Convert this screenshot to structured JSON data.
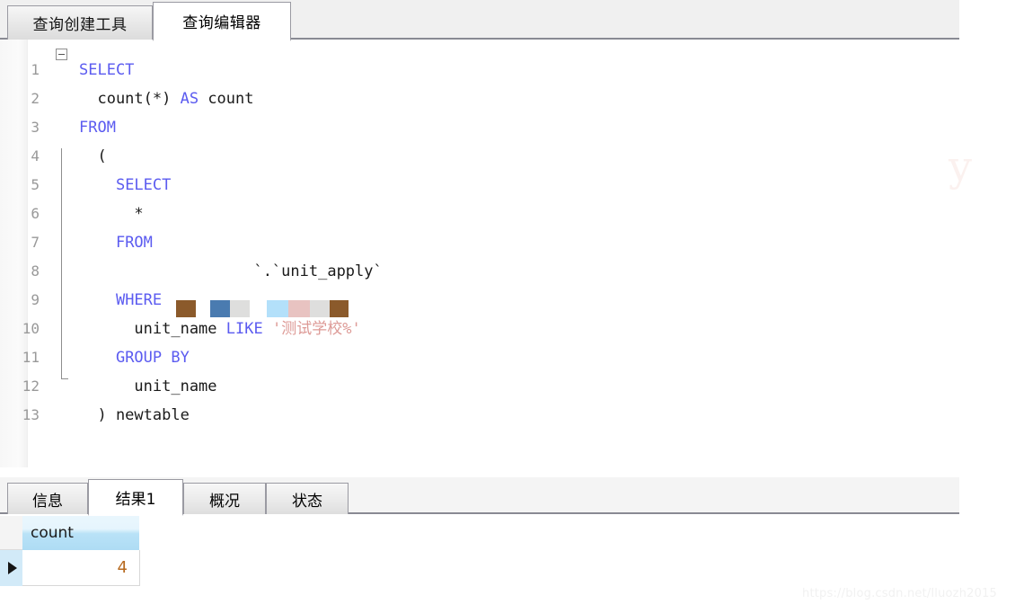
{
  "top_tabs": [
    {
      "label": "查询创建工具",
      "active": false
    },
    {
      "label": "查询编辑器",
      "active": true
    }
  ],
  "editor": {
    "lines": [
      {
        "no": "1",
        "tokens": [
          {
            "t": "SELECT",
            "c": "kw"
          }
        ]
      },
      {
        "no": "2",
        "tokens": [
          {
            "t": "  count(*) ",
            "c": "plain"
          },
          {
            "t": "AS",
            "c": "kw"
          },
          {
            "t": " count",
            "c": "plain"
          }
        ]
      },
      {
        "no": "3",
        "tokens": [
          {
            "t": "FROM",
            "c": "kw"
          }
        ]
      },
      {
        "no": "4",
        "tokens": [
          {
            "t": "  (",
            "c": "plain"
          }
        ]
      },
      {
        "no": "5",
        "tokens": [
          {
            "t": "    ",
            "c": "plain"
          },
          {
            "t": "SELECT",
            "c": "kw"
          }
        ]
      },
      {
        "no": "6",
        "tokens": [
          {
            "t": "      *",
            "c": "plain"
          }
        ]
      },
      {
        "no": "7",
        "tokens": [
          {
            "t": "    ",
            "c": "plain"
          },
          {
            "t": "FROM",
            "c": "kw"
          }
        ]
      },
      {
        "no": "8",
        "tokens": [
          {
            "t": "                   `.`unit_apply`",
            "c": "plain"
          }
        ]
      },
      {
        "no": "9",
        "tokens": [
          {
            "t": "    ",
            "c": "plain"
          },
          {
            "t": "WHERE",
            "c": "kw"
          }
        ]
      },
      {
        "no": "10",
        "tokens": [
          {
            "t": "      unit_name ",
            "c": "plain"
          },
          {
            "t": "LIKE",
            "c": "kw"
          },
          {
            "t": " ",
            "c": "plain"
          },
          {
            "t": "'测试学校%'",
            "c": "str"
          }
        ]
      },
      {
        "no": "11",
        "tokens": [
          {
            "t": "    ",
            "c": "plain"
          },
          {
            "t": "GROUP BY",
            "c": "kw"
          }
        ]
      },
      {
        "no": "12",
        "tokens": [
          {
            "t": "      unit_name",
            "c": "plain"
          }
        ]
      },
      {
        "no": "13",
        "tokens": [
          {
            "t": "  ) newtable",
            "c": "plain"
          }
        ]
      }
    ],
    "fold_marker": "collapse-minus",
    "redaction_blocks": [
      {
        "color": "#8b5a2b",
        "width": 22
      },
      {
        "color": "#ffffff",
        "width": 16
      },
      {
        "color": "#4a7bb0",
        "width": 22
      },
      {
        "color": "#dededd",
        "width": 22
      },
      {
        "color": "#ffffff",
        "width": 19
      },
      {
        "color": "#b3e0fa",
        "width": 24
      },
      {
        "color": "#e8c3c1",
        "width": 24
      },
      {
        "color": "#dededd",
        "width": 22
      },
      {
        "color": "#8b5a2b",
        "width": 21
      }
    ]
  },
  "result_tabs": [
    {
      "label": "信息",
      "active": false
    },
    {
      "label": "结果1",
      "active": true
    },
    {
      "label": "概况",
      "active": false
    },
    {
      "label": "状态",
      "active": false
    }
  ],
  "result_grid": {
    "columns": [
      "count"
    ],
    "rows": [
      [
        "4"
      ]
    ],
    "current_row_indicator": "play-triangle"
  },
  "watermarks": {
    "url": "https://blog.csdn.net/lluozh2015",
    "fragment": "y"
  },
  "colors": {
    "keyword": "#5b5bf0",
    "string": "#dd9a96",
    "number": "#b76a20",
    "grid_header": "#aedcf4",
    "tab_border": "#9a9aa2"
  }
}
